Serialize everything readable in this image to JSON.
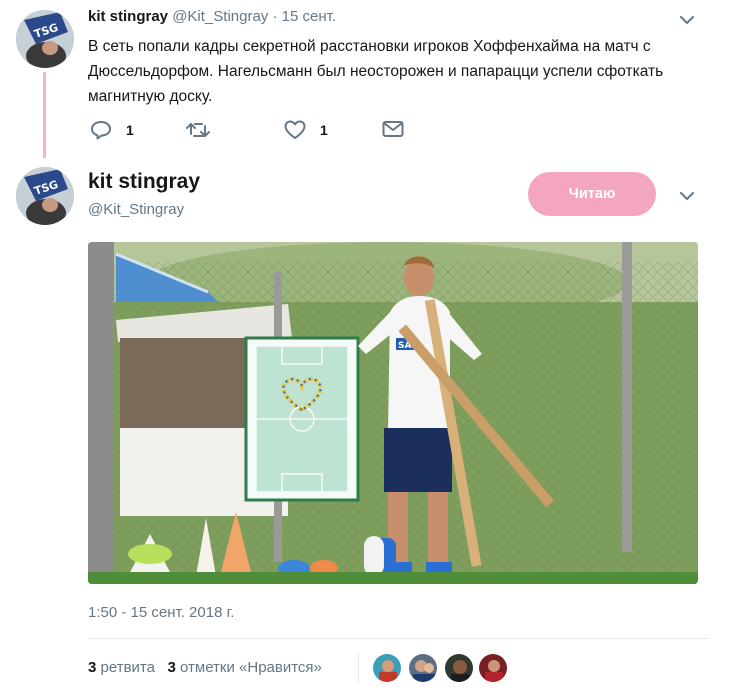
{
  "reply_tweet": {
    "author_name": "kit stingray",
    "handle": "@Kit_Stingray",
    "separator": "·",
    "time": "15 сент.",
    "text": "В сеть попали кадры секретной расстановки игроков Хоффенхайма на матч с Дюссельдорфом. Нагельсманн был неосторожен и папарацци успели сфоткать магнитную доску.",
    "replies_count": "1",
    "retweets_count": "",
    "likes_count": "1",
    "icons": [
      "reply-icon",
      "retweet-icon",
      "like-icon",
      "direct-message-icon",
      "chevron-down-icon"
    ]
  },
  "main_tweet": {
    "author_name": "kit stingray",
    "handle": "@Kit_Stingray",
    "follow_label": "Читаю",
    "timestamp": "1:50 - 15 сент. 2018 г.",
    "retweets_num": "3",
    "retweets_label": "ретвита",
    "likes_num": "3",
    "likes_label": "отметки «Нравится»",
    "liker_count": 4
  },
  "colors": {
    "accent": "#f3a6bd",
    "thread_line": "#f5b3c4",
    "muted_text": "#657786",
    "text": "#14171a"
  }
}
